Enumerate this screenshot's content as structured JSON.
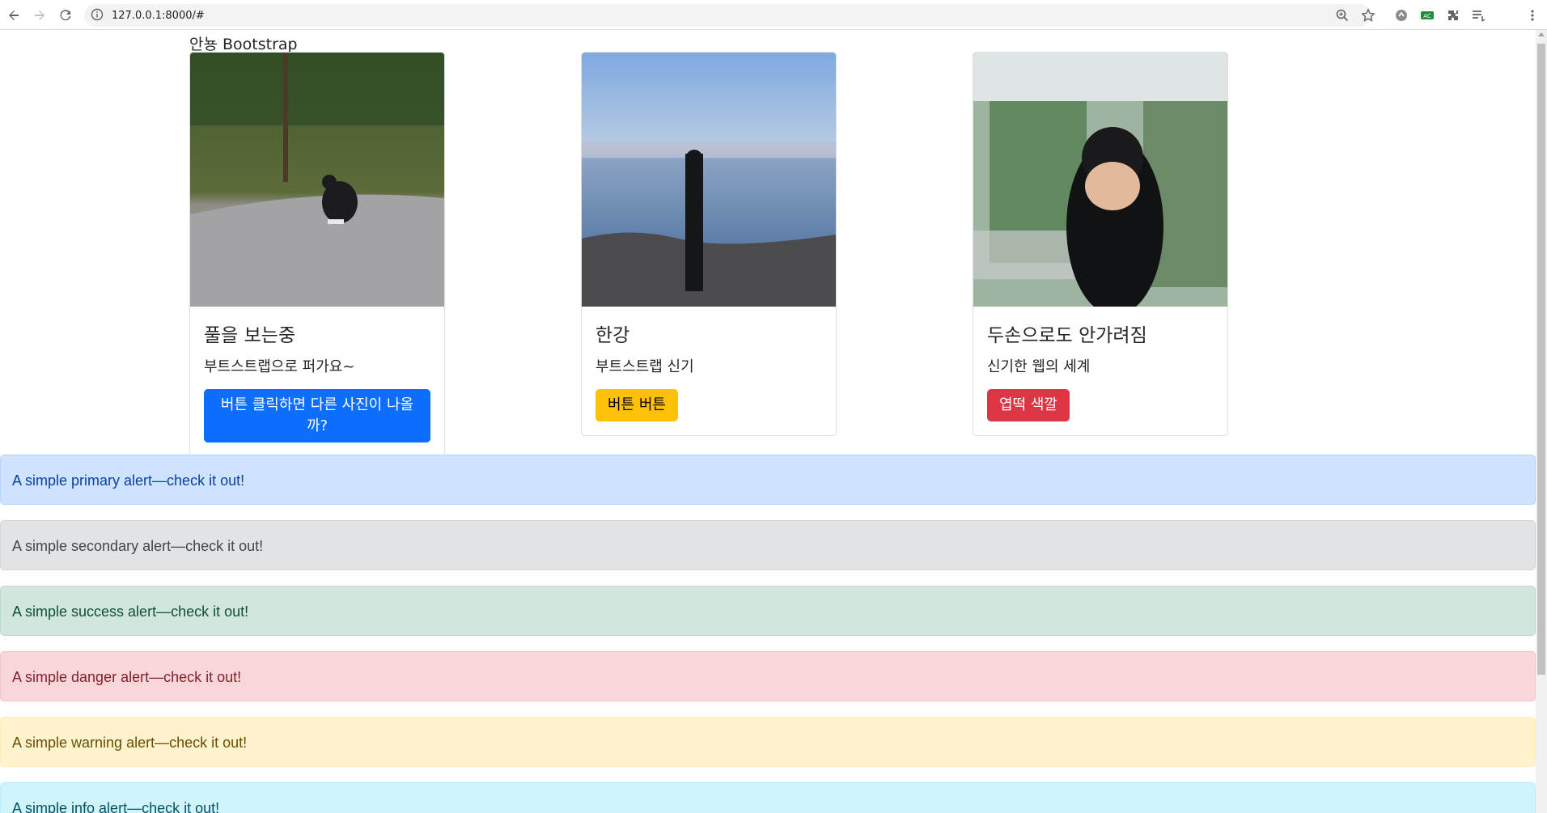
{
  "browser": {
    "url": "127.0.0.1:8000/#",
    "icons": [
      "back-icon",
      "forward-icon",
      "reload-icon",
      "info-icon",
      "zoom-icon",
      "star-icon",
      "extension-icon",
      "puzzle-icon",
      "reading-list-icon",
      "menu-icon"
    ]
  },
  "page": {
    "title": "안뇽 Bootstrap"
  },
  "cards": [
    {
      "title": "풀을 보는중",
      "text": "부트스트랩으로 퍼가요~",
      "button": "버튼 클릭하면 다른 사진이 나올까?",
      "button_style": "primary",
      "image": "person crouching on grass"
    },
    {
      "title": "한강",
      "text": "부트스트랩 신기",
      "button": "버튼 버튼",
      "button_style": "warning",
      "image": "person standing by river"
    },
    {
      "title": "두손으로도 안가려짐",
      "text": "신기한 웹의 세계",
      "button": "엽떡 색깔",
      "button_style": "danger",
      "image": "person covering face in greenhouse"
    }
  ],
  "alerts": [
    {
      "text": "A simple primary alert—check it out!",
      "style": "primary"
    },
    {
      "text": "A simple secondary alert—check it out!",
      "style": "secondary"
    },
    {
      "text": "A simple success alert—check it out!",
      "style": "success"
    },
    {
      "text": "A simple danger alert—check it out!",
      "style": "danger"
    },
    {
      "text": "A simple warning alert—check it out!",
      "style": "warning"
    },
    {
      "text": "A simple info alert—check it out!",
      "style": "info"
    }
  ],
  "colors": {
    "primary": "#0d6efd",
    "warning": "#ffc107",
    "danger": "#dc3545"
  }
}
